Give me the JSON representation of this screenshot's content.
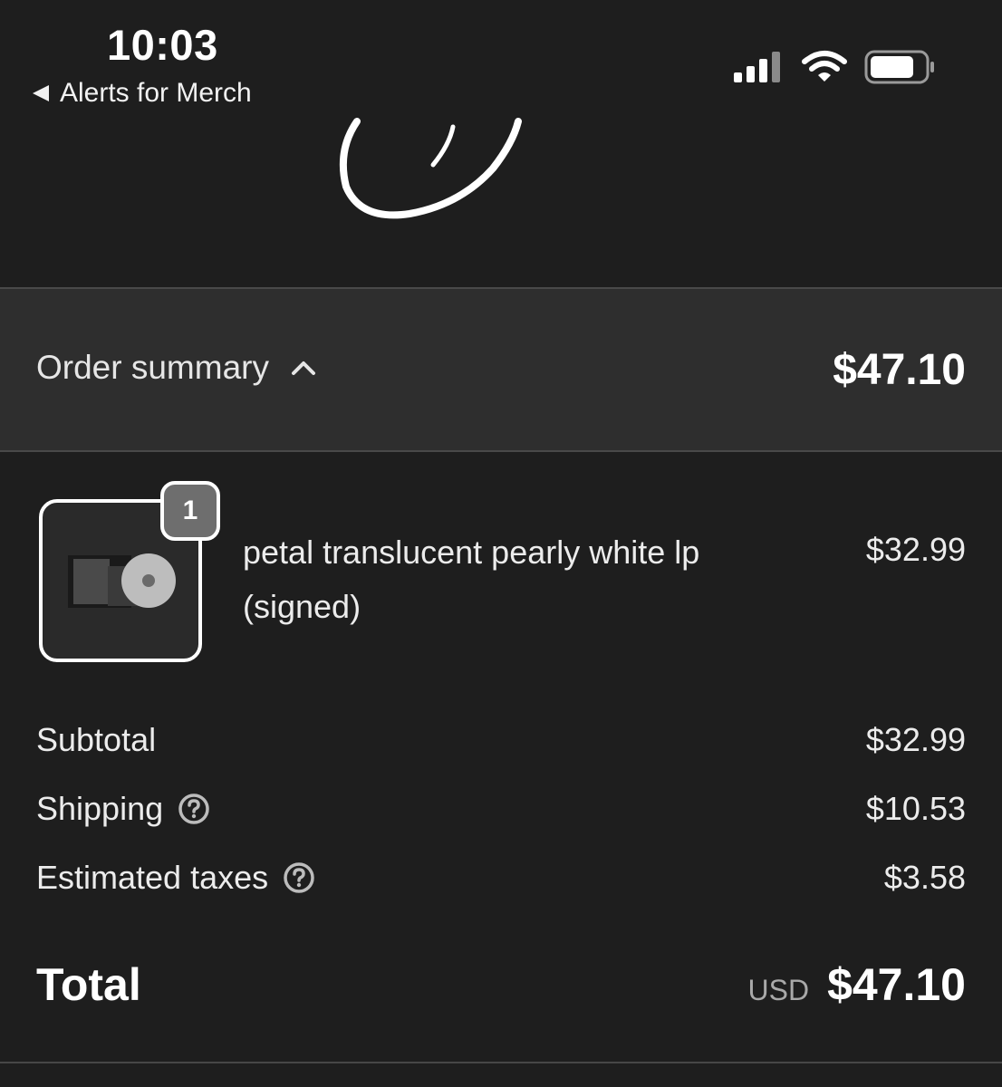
{
  "status_bar": {
    "time": "10:03",
    "back_label": "Alerts for Merch",
    "icons": [
      "signal-icon",
      "wifi-icon",
      "battery-icon"
    ]
  },
  "order_summary": {
    "toggle_label": "Order summary",
    "toggle_icon": "chevron-up-icon",
    "total": "$47.10"
  },
  "line_item": {
    "quantity": "1",
    "name": "petal translucent pearly white lp (signed)",
    "price": "$32.99"
  },
  "costs": {
    "subtotal_label": "Subtotal",
    "subtotal_value": "$32.99",
    "shipping_label": "Shipping",
    "shipping_value": "$10.53",
    "taxes_label": "Estimated taxes",
    "taxes_value": "$3.58"
  },
  "total": {
    "label": "Total",
    "currency": "USD",
    "value": "$47.10"
  },
  "colors": {
    "background": "#1e1e1e",
    "summary_bar": "#2e2e2e",
    "badge": "#6e6e6e",
    "text": "#ececec"
  }
}
